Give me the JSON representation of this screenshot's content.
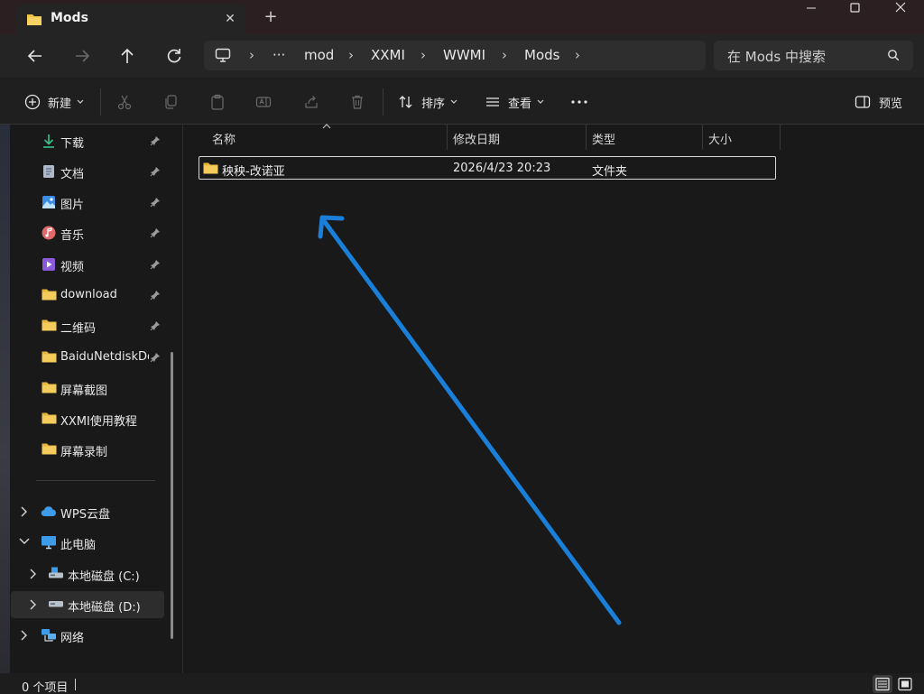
{
  "window": {
    "tab_title": "Mods",
    "tab_close_glyph": "✕",
    "new_tab_glyph": "+"
  },
  "address": {
    "overflow": "···",
    "crumbs": [
      "mod",
      "XXMI",
      "WWMI",
      "Mods"
    ],
    "separator": "›"
  },
  "search": {
    "placeholder": "在 Mods 中搜索"
  },
  "toolbar": {
    "new_label": "新建",
    "sort_label": "排序",
    "view_label": "查看",
    "more_glyph": "···",
    "preview_label": "预览"
  },
  "sidebar": {
    "quick_access": [
      {
        "label": "下载",
        "icon": "download-icon"
      },
      {
        "label": "文档",
        "icon": "document-icon"
      },
      {
        "label": "图片",
        "icon": "picture-icon"
      },
      {
        "label": "音乐",
        "icon": "music-icon"
      },
      {
        "label": "视频",
        "icon": "video-icon"
      },
      {
        "label": "download",
        "icon": "folder-icon"
      },
      {
        "label": "二维码",
        "icon": "folder-icon"
      },
      {
        "label": "BaiduNetdiskDownload",
        "icon": "folder-icon"
      },
      {
        "label": "屏幕截图",
        "icon": "folder-icon"
      },
      {
        "label": "XXMI使用教程",
        "icon": "folder-icon"
      },
      {
        "label": "屏幕录制",
        "icon": "folder-icon"
      }
    ],
    "tree": {
      "wps": "WPS云盘",
      "this_pc": "此电脑",
      "drive_c": "本地磁盘 (C:)",
      "drive_d": "本地磁盘 (D:)",
      "network": "网络"
    }
  },
  "list": {
    "columns": {
      "name": "名称",
      "modified": "修改日期",
      "type": "类型",
      "size": "大小"
    },
    "rows": [
      {
        "name": "秧秧-改诺亚",
        "modified": "2026/4/23 20:23",
        "type": "文件夹",
        "size": ""
      }
    ]
  },
  "status": {
    "item_count": "0 个项目"
  },
  "colors": {
    "accent": "#0078d4",
    "folder": "#f2c247",
    "arrow": "#1a7fd9"
  }
}
